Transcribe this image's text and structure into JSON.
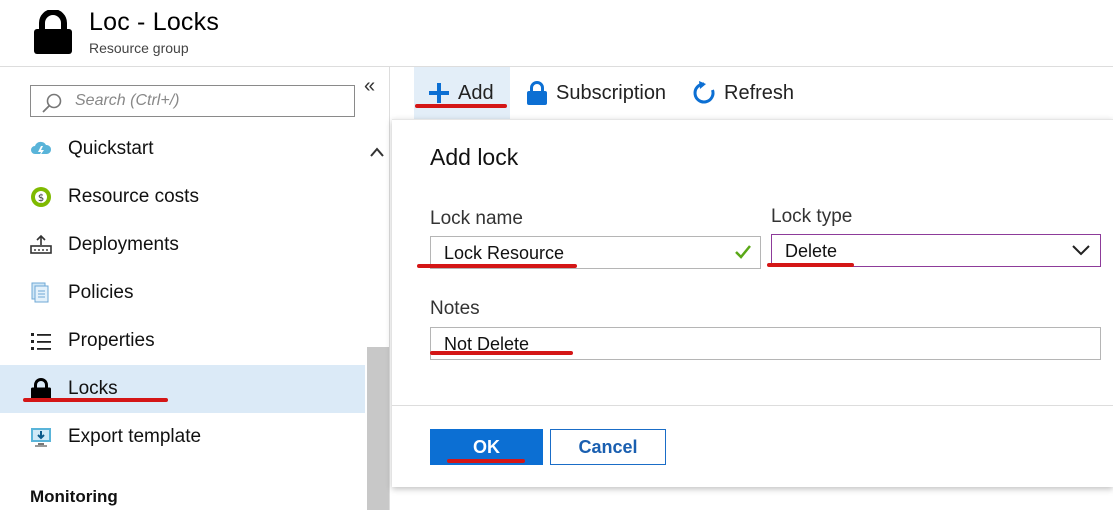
{
  "header": {
    "title": "Loc - Locks",
    "subtitle": "Resource group"
  },
  "sidebar": {
    "collapse_glyph": "«",
    "search_placeholder": "Search (Ctrl+/)",
    "items": [
      {
        "label": "Quickstart",
        "icon": "cloud-lightning-icon"
      },
      {
        "label": "Resource costs",
        "icon": "cost-circle-icon"
      },
      {
        "label": "Deployments",
        "icon": "deployments-icon"
      },
      {
        "label": "Policies",
        "icon": "policies-icon"
      },
      {
        "label": "Properties",
        "icon": "properties-list-icon"
      },
      {
        "label": "Locks",
        "icon": "lock-icon"
      },
      {
        "label": "Export template",
        "icon": "export-template-icon"
      }
    ],
    "active_item": "Locks",
    "section_monitoring": "Monitoring"
  },
  "toolbar": {
    "add_label": "Add",
    "subscription_label": "Subscription",
    "refresh_label": "Refresh"
  },
  "dialog": {
    "title": "Add lock",
    "lock_name_label": "Lock name",
    "lock_name_value": "Lock Resource",
    "lock_type_label": "Lock type",
    "lock_type_value": "Delete",
    "notes_label": "Notes",
    "notes_value": "Not Delete",
    "ok_label": "OK",
    "cancel_label": "Cancel"
  },
  "colors": {
    "accent_blue": "#0c6fd3",
    "active_nav_bg": "#dbeaf7",
    "annotation_red": "#d41616",
    "valid_green": "#5aa817",
    "select_border": "#8d3b9a"
  }
}
